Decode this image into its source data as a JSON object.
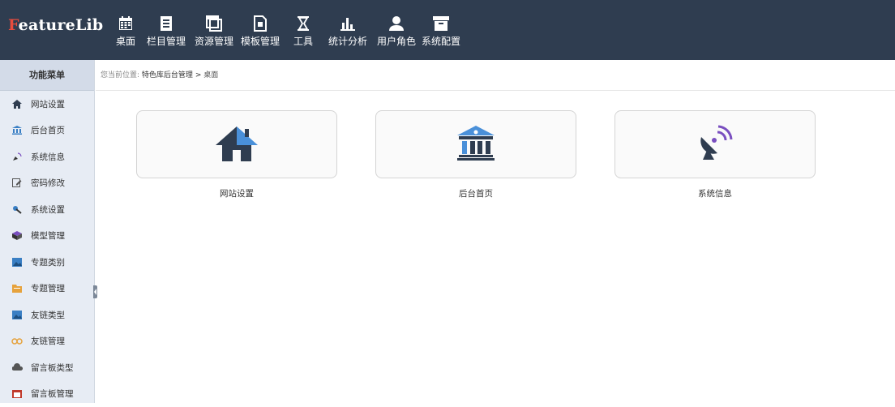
{
  "app": {
    "logo_first": "F",
    "logo_rest": "eatureLib"
  },
  "topnav": [
    {
      "label": "桌面",
      "icon": "calendar-icon"
    },
    {
      "label": "栏目管理",
      "icon": "document-icon"
    },
    {
      "label": "资源管理",
      "icon": "copy-icon"
    },
    {
      "label": "模板管理",
      "icon": "file-icon"
    },
    {
      "label": "工具",
      "icon": "hourglass-icon"
    },
    {
      "label": "统计分析",
      "icon": "bar-chart-icon"
    },
    {
      "label": "用户角色",
      "icon": "user-icon"
    },
    {
      "label": "系统配置",
      "icon": "archive-icon"
    }
  ],
  "sidebar": {
    "title": "功能菜单",
    "items": [
      {
        "label": "网站设置",
        "icon": "home-icon",
        "color": "#2f3d50"
      },
      {
        "label": "后台首页",
        "icon": "bank-icon",
        "color": "#3a7fc4"
      },
      {
        "label": "系统信息",
        "icon": "satellite-icon",
        "color": "#7a4fc0"
      },
      {
        "label": "密码修改",
        "icon": "edit-icon",
        "color": "#555555"
      },
      {
        "label": "系统设置",
        "icon": "wrench-icon",
        "color": "#3a7fc4"
      },
      {
        "label": "模型管理",
        "icon": "cube-icon",
        "color": "#7a4fc0"
      },
      {
        "label": "专题类别",
        "icon": "image-icon",
        "color": "#3a7fc4"
      },
      {
        "label": "专题管理",
        "icon": "folder-icon",
        "color": "#e6a23c"
      },
      {
        "label": "友链类型",
        "icon": "image-icon",
        "color": "#3a7fc4"
      },
      {
        "label": "友链管理",
        "icon": "link-icon",
        "color": "#e6a23c"
      },
      {
        "label": "留言板类型",
        "icon": "cloud-icon",
        "color": "#555555"
      },
      {
        "label": "留言板管理",
        "icon": "calendar-icon",
        "color": "#c0392b"
      }
    ]
  },
  "breadcrumb": {
    "prefix": "您当前位置:",
    "path": "特色库后台管理",
    "sep": ">",
    "current": "桌面"
  },
  "tiles": [
    {
      "label": "网站设置",
      "icon": "home-icon"
    },
    {
      "label": "后台首页",
      "icon": "bank-icon"
    },
    {
      "label": "系统信息",
      "icon": "satellite-icon"
    }
  ],
  "colors": {
    "topbar": "#2f3d50",
    "sidebar": "#e7ecf4",
    "accent": "#3a7fc4",
    "logo_first": "#e84c3d"
  }
}
